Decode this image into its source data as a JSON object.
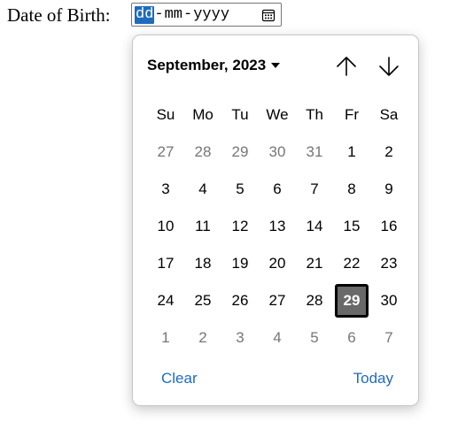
{
  "form": {
    "label": "Date of Birth:",
    "date_input": {
      "day": "dd",
      "sep1": "-",
      "month": "mm",
      "sep2": "-",
      "year": "yyyy",
      "active_segment": "day"
    }
  },
  "picker": {
    "month_label": "September, 2023",
    "nav_up_icon": "arrow-up-icon",
    "nav_down_icon": "arrow-down-icon",
    "weekdays": [
      "Su",
      "Mo",
      "Tu",
      "We",
      "Th",
      "Fr",
      "Sa"
    ],
    "weeks": [
      [
        {
          "d": "27",
          "muted": true
        },
        {
          "d": "28",
          "muted": true
        },
        {
          "d": "29",
          "muted": true
        },
        {
          "d": "30",
          "muted": true
        },
        {
          "d": "31",
          "muted": true
        },
        {
          "d": "1"
        },
        {
          "d": "2"
        }
      ],
      [
        {
          "d": "3"
        },
        {
          "d": "4"
        },
        {
          "d": "5"
        },
        {
          "d": "6"
        },
        {
          "d": "7"
        },
        {
          "d": "8"
        },
        {
          "d": "9"
        }
      ],
      [
        {
          "d": "10"
        },
        {
          "d": "11"
        },
        {
          "d": "12"
        },
        {
          "d": "13"
        },
        {
          "d": "14"
        },
        {
          "d": "15"
        },
        {
          "d": "16"
        }
      ],
      [
        {
          "d": "17"
        },
        {
          "d": "18"
        },
        {
          "d": "19"
        },
        {
          "d": "20"
        },
        {
          "d": "21"
        },
        {
          "d": "22"
        },
        {
          "d": "23"
        }
      ],
      [
        {
          "d": "24"
        },
        {
          "d": "25"
        },
        {
          "d": "26"
        },
        {
          "d": "27"
        },
        {
          "d": "28"
        },
        {
          "d": "29",
          "selected": true
        },
        {
          "d": "30"
        }
      ],
      [
        {
          "d": "1",
          "muted": true
        },
        {
          "d": "2",
          "muted": true
        },
        {
          "d": "3",
          "muted": true
        },
        {
          "d": "4",
          "muted": true
        },
        {
          "d": "5",
          "muted": true
        },
        {
          "d": "6",
          "muted": true
        },
        {
          "d": "7",
          "muted": true
        }
      ]
    ],
    "clear_label": "Clear",
    "today_label": "Today"
  },
  "colors": {
    "accent": "#1f6bbd",
    "selected_bg": "#696969",
    "muted_text": "#767676"
  },
  "icons": {
    "calendar": "calendar-icon",
    "month_dropdown": "caret-down-icon"
  }
}
